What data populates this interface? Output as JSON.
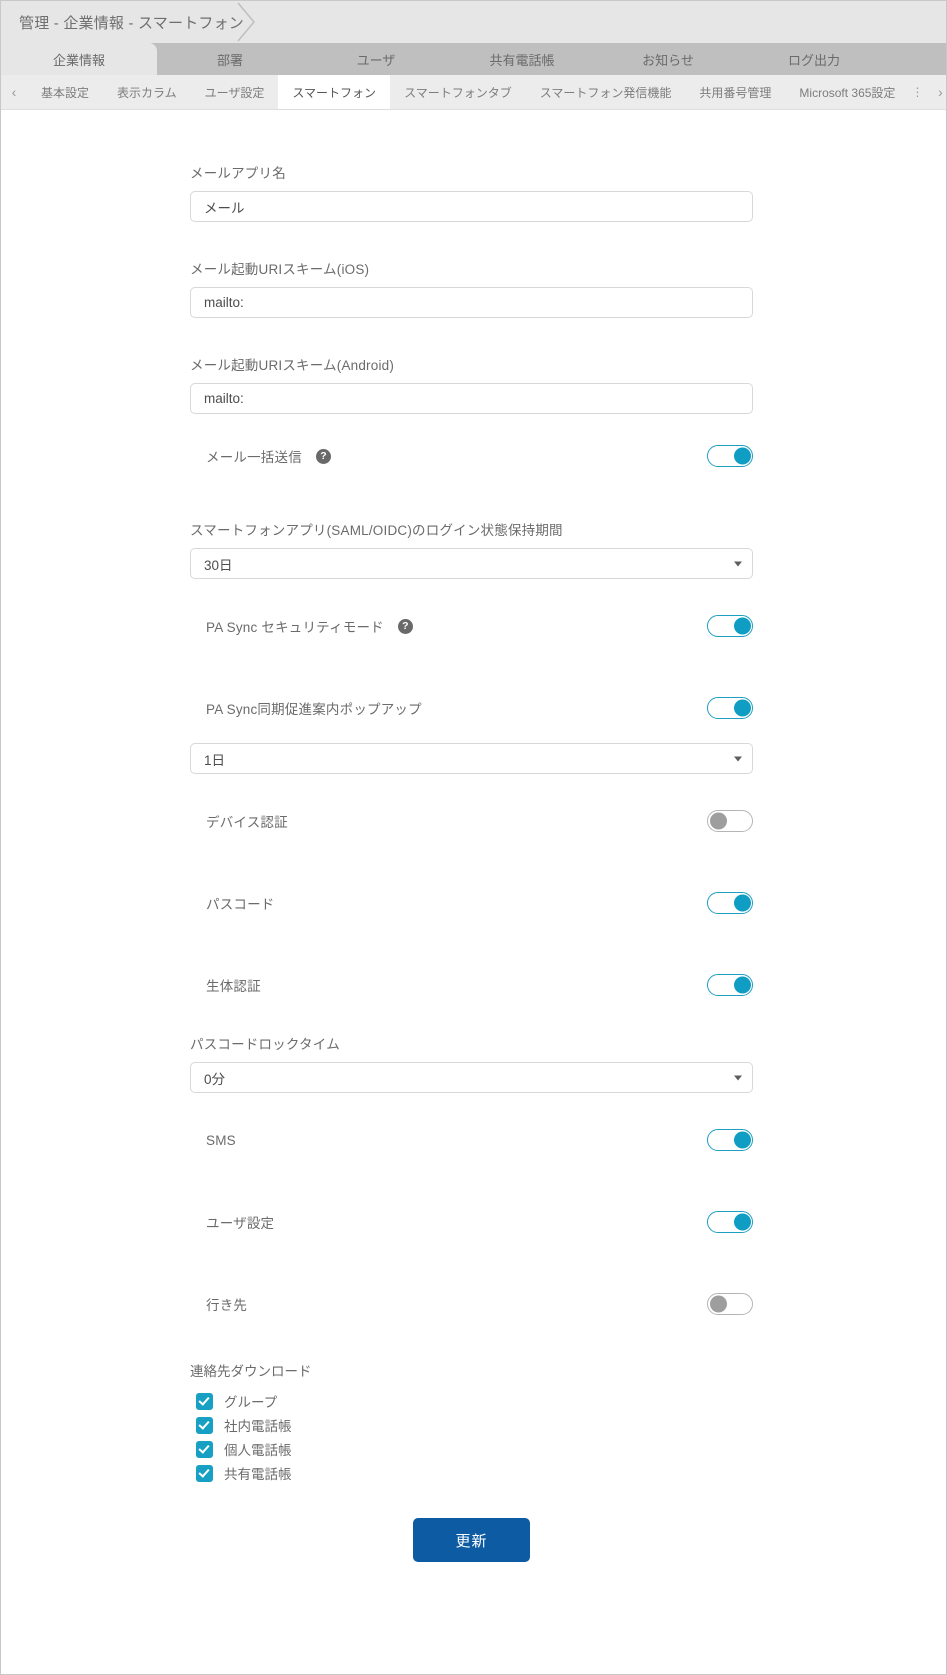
{
  "breadcrumb": {
    "text": "管理 - 企業情報 - スマートフォン"
  },
  "primary_tabs": [
    {
      "label": "企業情報",
      "active": true
    },
    {
      "label": "部署",
      "active": false
    },
    {
      "label": "ユーザ",
      "active": false
    },
    {
      "label": "共有電話帳",
      "active": false
    },
    {
      "label": "お知らせ",
      "active": false
    },
    {
      "label": "ログ出力",
      "active": false
    }
  ],
  "sub_tabs": {
    "prev_arrow": "‹",
    "next_arrow": "›",
    "kebab": "⋮",
    "items": [
      {
        "label": "基本設定",
        "active": false
      },
      {
        "label": "表示カラム",
        "active": false
      },
      {
        "label": "ユーザ設定",
        "active": false
      },
      {
        "label": "スマートフォン",
        "active": true
      },
      {
        "label": "スマートフォンタブ",
        "active": false
      },
      {
        "label": "スマートフォン発信機能",
        "active": false
      },
      {
        "label": "共用番号管理",
        "active": false
      },
      {
        "label": "Microsoft 365設定",
        "active": false
      }
    ]
  },
  "form": {
    "mail_app_name": {
      "label": "メールアプリ名",
      "value": "メール"
    },
    "mail_uri_ios": {
      "label": "メール起動URIスキーム(iOS)",
      "value": "mailto:"
    },
    "mail_uri_android": {
      "label": "メール起動URIスキーム(Android)",
      "value": "mailto:"
    },
    "mail_bulk_send": {
      "label": "メール一括送信",
      "help": "?",
      "state": "on"
    },
    "login_retention": {
      "label": "スマートフォンアプリ(SAML/OIDC)のログイン状態保持期間",
      "value": "30日"
    },
    "pa_sync_security": {
      "label": "PA Sync セキュリティモード",
      "help": "?",
      "state": "on"
    },
    "pa_sync_popup": {
      "label": "PA Sync同期促進案内ポップアップ",
      "state": "on"
    },
    "pa_sync_popup_interval": {
      "value": "1日"
    },
    "device_auth": {
      "label": "デバイス認証",
      "state": "off"
    },
    "passcode": {
      "label": "パスコード",
      "state": "on"
    },
    "biometric": {
      "label": "生体認証",
      "state": "on"
    },
    "passcode_lock_time": {
      "label": "パスコードロックタイム",
      "value": "0分"
    },
    "sms": {
      "label": "SMS",
      "state": "on"
    },
    "user_settings": {
      "label": "ユーザ設定",
      "state": "on"
    },
    "destination": {
      "label": "行き先",
      "state": "off"
    },
    "contact_download": {
      "label": "連絡先ダウンロード",
      "options": [
        {
          "label": "グループ",
          "checked": true
        },
        {
          "label": "社内電話帳",
          "checked": true
        },
        {
          "label": "個人電話帳",
          "checked": true
        },
        {
          "label": "共有電話帳",
          "checked": true
        }
      ]
    },
    "submit": {
      "label": "更新"
    }
  },
  "colors": {
    "accent_teal": "#0f9dc4",
    "submit_blue": "#0d5ba3",
    "tab_bar_gray": "#bfbfbf",
    "breadcrumb_gray": "#e6e6e6"
  }
}
